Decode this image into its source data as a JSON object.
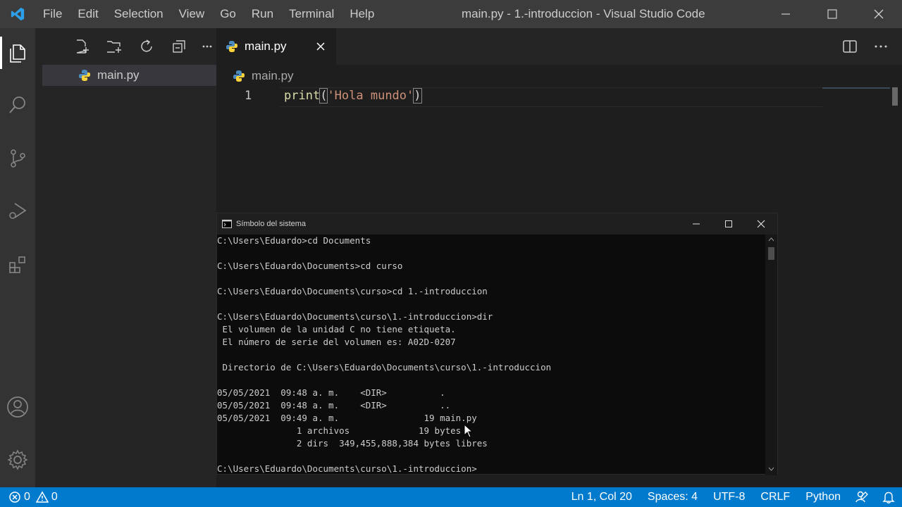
{
  "titlebar": {
    "menu": [
      "File",
      "Edit",
      "Selection",
      "View",
      "Go",
      "Run",
      "Terminal",
      "Help"
    ],
    "title": "main.py - 1.-introduccion - Visual Studio Code"
  },
  "sidebar": {
    "files": [
      {
        "name": "main.py",
        "icon": "python-file-icon"
      }
    ]
  },
  "editor": {
    "tab": {
      "label": "main.py"
    },
    "breadcrumb": "main.py",
    "lines": [
      {
        "number": "1",
        "fn": "print",
        "open": "(",
        "str": "'Hola mundo'",
        "close": ")"
      }
    ]
  },
  "cmd": {
    "title": "Símbolo del sistema",
    "lines": [
      "C:\\Users\\Eduardo>cd Documents",
      "",
      "C:\\Users\\Eduardo\\Documents>cd curso",
      "",
      "C:\\Users\\Eduardo\\Documents\\curso>cd 1.-introduccion",
      "",
      "C:\\Users\\Eduardo\\Documents\\curso\\1.-introduccion>dir",
      " El volumen de la unidad C no tiene etiqueta.",
      " El número de serie del volumen es: A02D-0207",
      "",
      " Directorio de C:\\Users\\Eduardo\\Documents\\curso\\1.-introduccion",
      "",
      "05/05/2021  09:48 a. m.    <DIR>          .",
      "05/05/2021  09:48 a. m.    <DIR>          ..",
      "05/05/2021  09:49 a. m.                19 main.py",
      "               1 archivos             19 bytes",
      "               2 dirs  349,455,888,384 bytes libres",
      "",
      "C:\\Users\\Eduardo\\Documents\\curso\\1.-introduccion>"
    ]
  },
  "statusbar": {
    "errors": "0",
    "warnings": "0",
    "position": "Ln 1, Col 20",
    "spaces": "Spaces: 4",
    "encoding": "UTF-8",
    "eol": "CRLF",
    "language": "Python"
  },
  "colors": {
    "accent": "#007acc",
    "titlebar": "#3c3c3c",
    "activitybar": "#333333",
    "sidebar": "#252526",
    "editor": "#1e1e1e",
    "cmd": "#0c0c0c"
  }
}
